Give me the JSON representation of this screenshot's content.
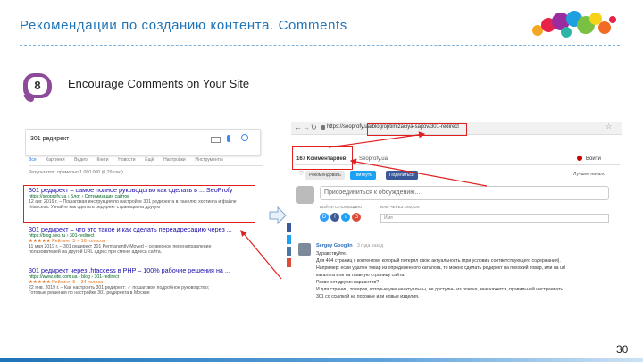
{
  "slide": {
    "title": "Рекомендации по созданию контента. Comments",
    "badge_number": "8",
    "heading": "Encourage Comments on Your Site",
    "page_number": "30"
  },
  "colors": {
    "title_blue": "#1f73b7",
    "badge_purple": "#8d4a9a",
    "highlight_red": "#e02020",
    "link_blue": "#1a0dab",
    "url_green": "#006621"
  },
  "left_screenshot": {
    "search_query": "301 редирект",
    "tabs": [
      "Все",
      "Картинки",
      "Видео",
      "Книги",
      "Новости",
      "Ещё",
      "Настройки",
      "Инструменты"
    ],
    "results_count": "Результатов: примерно 1 060 000 (0,29 сек.)",
    "results": [
      {
        "title": "301 редирект – самое полное руководство как сделать в ... SeoProfy",
        "url": "https://seoprofy.ua › Блог › Оптимизация сайтов",
        "rating": "",
        "snippet1": "12 авг. 2019 г. – Пошаговая инструкция по настройке 301 редиректа в панелях хостинга и файле",
        "snippet2": ".htaccess. Узнайте как сделать редирект страницы на другую"
      },
      {
        "title": "301 редирект – что это такое и как сделать переадресацию через ...",
        "url": "https://blog.seo.ru › 301-redirect",
        "rating": "★★★★★ Рейтинг: 5 – 16 голосов",
        "snippet1": "11 мая 2019 г. – 301 редирект 301 Permanently Moved – серверное перенаправление",
        "snippet2": "пользователей на другой URL адрес при смене адреса сайта."
      },
      {
        "title": "301 редирект через .htaccess в PHP – 100% рабочие решения на ...",
        "url": "https://www.site.com.ua › blog › 301-redirect",
        "rating": "★★★★★ Рейтинг: 5 – 34 голоса",
        "snippet1": "22 янв. 2019 г. – Как настроить 301 редирект: ✓ пошаговое подробное руководство;",
        "snippet2": "Готовые решения по настройке 301 редиректа в Москве"
      }
    ]
  },
  "right_screenshot": {
    "url": "https://seoprofy.ua/blog/optimizaciya-sajtov/301-redirect",
    "comments_count": "167 Комментариев",
    "site_tab": "Seoprofy.ua",
    "login": "Войти",
    "sort_label": "Лучшее начало",
    "recommend": "Рекомендовать",
    "tweet": "Твитнуть",
    "share": "Поделиться",
    "join_placeholder": "Присоединиться к обсуждению...",
    "login_with": "ВОЙТИ С ПОМОЩЬЮ",
    "or_disqus": "ИЛИ ЧЕРЕЗ DISQUS",
    "name_placeholder": "Имя",
    "comment": {
      "author": "Sergey Googlin",
      "time": "3 года назад",
      "lines": [
        "Здравствуйте.",
        "Для 404 страниц с контентом, который потерял свою актуальность (при условии соответствующего содержания).",
        "Например: если удален товар из определенного каталога, то можно сделать редирект на похожий товар, или на url",
        "каталога или на главную страницу сайта.",
        "Разве нет других вариантов?",
        "И для страниц, товаров, которые уже неактуальны, не доступны из поиска, мне кажется, правильней настраивать",
        "301 со ссылкой на похожие или новые изделия."
      ]
    }
  }
}
